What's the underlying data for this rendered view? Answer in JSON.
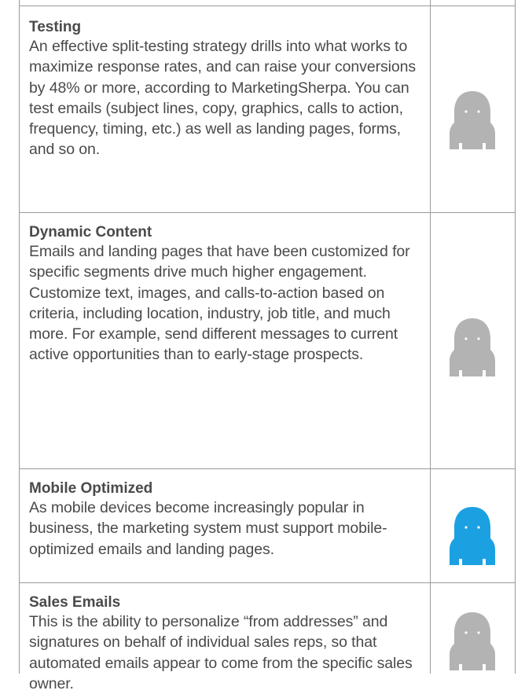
{
  "colors": {
    "robot_inactive": "#b3b3b3",
    "robot_active": "#1ba1e2",
    "rule": "#9a9a9a",
    "text": "#4a4a4a"
  },
  "rows": [
    {
      "title": "Testing",
      "body": "An effective split-testing strategy drills into what works to maximize response rates, and can raise your conversions by 48% or more, according to MarketingSherpa. You can test emails (subject lines, copy, graphics, calls to action, frequency, timing, etc.) as well as landing pages, forms, and so on.",
      "icon": "robot-icon",
      "icon_state": "inactive"
    },
    {
      "title": "Dynamic Content",
      "body": "Emails and landing pages that have been customized for specific segments drive much higher engagement. Customize text, images, and calls-to-action based on criteria, including location, industry, job title, and much more. For example, send different messages to current active opportunities than to early-stage prospects.",
      "icon": "robot-icon",
      "icon_state": "inactive"
    },
    {
      "title": "Mobile Optimized",
      "body": "As mobile devices become increasingly popular in business, the marketing system must support mobile-optimized emails and landing pages.",
      "icon": "robot-icon",
      "icon_state": "active"
    },
    {
      "title": "Sales Emails",
      "body": "This is the ability to personalize “from addresses” and signatures on behalf of individual sales reps, so that automated emails appear to come from the specific sales owner.",
      "icon": "robot-icon",
      "icon_state": "inactive"
    }
  ]
}
